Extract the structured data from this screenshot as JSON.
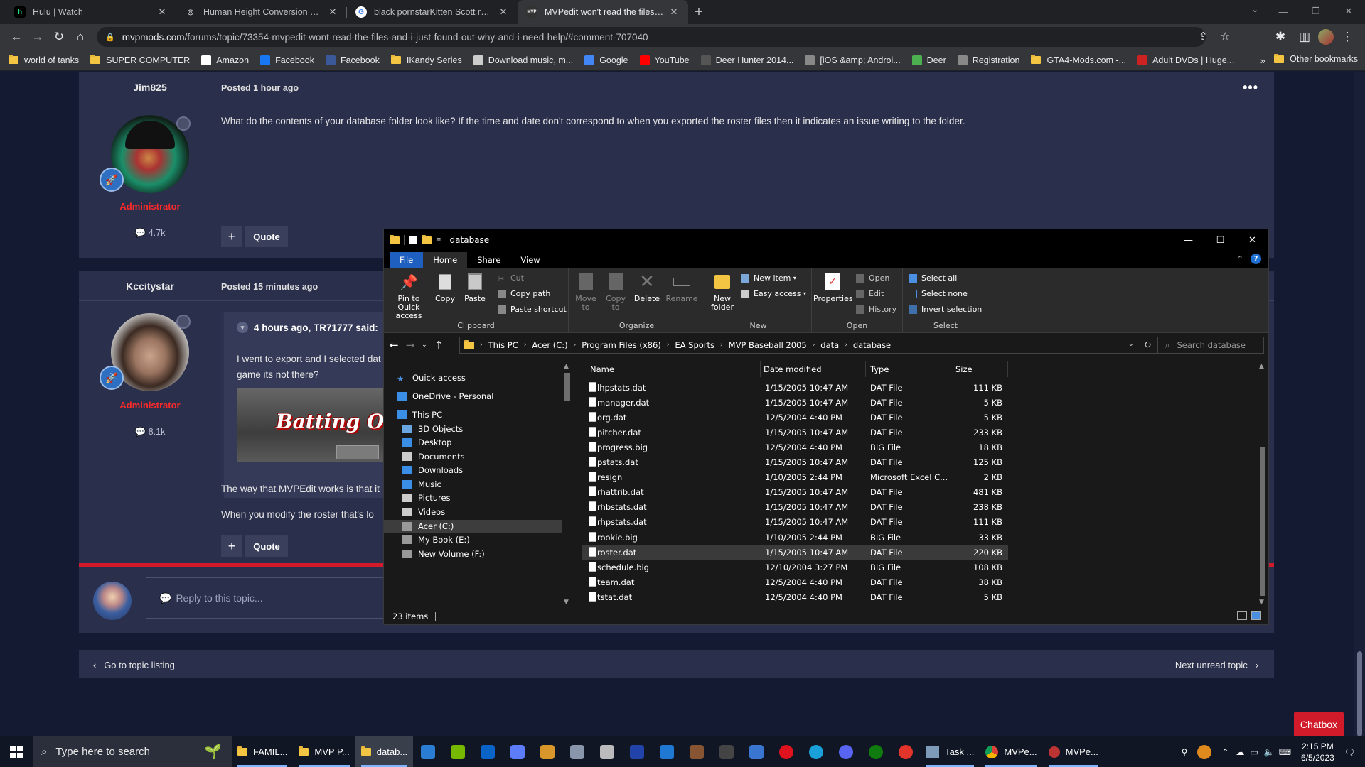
{
  "browser": {
    "tabs": [
      {
        "title": "Hulu | Watch",
        "fav": "h",
        "fav_color": "#1ce783",
        "fav_bg": "#000"
      },
      {
        "title": "Human Height Conversion Table",
        "fav": "◎",
        "fav_color": "#bdc1c6",
        "fav_bg": "transparent"
      },
      {
        "title": "black pornstarKitten Scott real na",
        "fav": "G",
        "fav_color": "#4285f4",
        "fav_bg": "#fff"
      },
      {
        "title": "MVPedit won't read the files and",
        "fav": "MVP",
        "fav_color": "#fff",
        "fav_bg": "#333"
      }
    ],
    "url_host": "mvpmods.com",
    "url_path": "/forums/topic/73354-mvpedit-wont-read-the-files-and-i-just-found-out-why-and-i-need-help/#comment-707040",
    "bookmarks": [
      {
        "label": "world of tanks",
        "icon": "folder-icon",
        "color": "#f4c542"
      },
      {
        "label": "SUPER COMPUTER",
        "icon": "folder-icon",
        "color": "#f4c542"
      },
      {
        "label": "Amazon",
        "icon": "amazon-icon",
        "color": "#fff"
      },
      {
        "label": "Facebook",
        "icon": "facebook-icon",
        "color": "#1877f2"
      },
      {
        "label": "Facebook",
        "icon": "facebook-icon",
        "color": "#3b5998"
      },
      {
        "label": "IKandy Series",
        "icon": "folder-icon",
        "color": "#f4c542"
      },
      {
        "label": "Download music, m...",
        "icon": "download-icon",
        "color": "#ccc"
      },
      {
        "label": "Google",
        "icon": "google-icon",
        "color": "#4285f4"
      },
      {
        "label": "YouTube",
        "icon": "youtube-icon",
        "color": "#ff0000"
      },
      {
        "label": "Deer Hunter 2014...",
        "icon": "deer-icon",
        "color": "#555"
      },
      {
        "label": "[iOS &amp; Androi...",
        "icon": "web-icon",
        "color": "#888"
      },
      {
        "label": "Deer",
        "icon": "check-icon",
        "color": "#4caf50"
      },
      {
        "label": "Registration",
        "icon": "web-icon",
        "color": "#888"
      },
      {
        "label": "GTA4-Mods.com -...",
        "icon": "folder-icon",
        "color": "#f4c542"
      },
      {
        "label": "Adult DVDs | Huge...",
        "icon": "star-icon",
        "color": "#c22"
      }
    ],
    "more": "»",
    "other_bookmarks": "Other bookmarks"
  },
  "forum": {
    "post1": {
      "author": "Jim825",
      "posted": "Posted 1 hour ago",
      "role": "Administrator",
      "rep": "4.7k",
      "text": "What do the contents of your database folder look like?  If the time and  date don't correspond to when you exported the roster files then it indicates an issue writing to the folder.",
      "plus": "+",
      "quote": "Quote",
      "more": "•••"
    },
    "post2": {
      "author": "Kccitystar",
      "posted": "Posted 15 minutes ago",
      "role": "Administrator",
      "rep": "8.1k",
      "quote_head": "4 hours ago, TR71777 said:",
      "quote_line1": "I went to export and I selected dat",
      "quote_line2": "game its not there?",
      "quote_img_text": "Batting Ord",
      "text1": "The way that MVPEdit works is that it",
      "text2": "When you modify the roster that's lo",
      "plus": "+",
      "quote": "Quote"
    },
    "reply_placeholder": "Reply to this topic...",
    "go_to_listing": "Go to topic listing",
    "next_unread": "Next unread topic",
    "chatbox": "Chatbox"
  },
  "explorer": {
    "title": "database",
    "tabs": [
      "File",
      "Home",
      "Share",
      "View"
    ],
    "ribbon": {
      "clipboard": {
        "name": "Clipboard",
        "pin": "Pin to Quick access",
        "copy": "Copy",
        "paste": "Paste",
        "cut": "Cut",
        "copy_path": "Copy path",
        "paste_shortcut": "Paste shortcut"
      },
      "organize": {
        "name": "Organize",
        "move_to": "Move to",
        "copy_to": "Copy to",
        "delete": "Delete",
        "rename": "Rename"
      },
      "new": {
        "name": "New",
        "new_folder": "New folder",
        "new_item": "New item",
        "easy_access": "Easy access"
      },
      "open": {
        "name": "Open",
        "properties": "Properties",
        "open": "Open",
        "edit": "Edit",
        "history": "History"
      },
      "select": {
        "name": "Select",
        "select_all": "Select all",
        "select_none": "Select none",
        "invert": "Invert selection"
      }
    },
    "breadcrumb": [
      "This PC",
      "Acer (C:)",
      "Program Files (x86)",
      "EA Sports",
      "MVP Baseball 2005",
      "data",
      "database"
    ],
    "search_placeholder": "Search database",
    "nav": [
      {
        "label": "Quick access",
        "icon": "star-icon"
      },
      {
        "label": "OneDrive - Personal",
        "icon": "cloud-icon"
      },
      {
        "label": "This PC",
        "icon": "pc-icon"
      },
      {
        "label": "3D Objects",
        "icon": "cube-icon"
      },
      {
        "label": "Desktop",
        "icon": "desktop-icon"
      },
      {
        "label": "Documents",
        "icon": "document-icon"
      },
      {
        "label": "Downloads",
        "icon": "download-icon"
      },
      {
        "label": "Music",
        "icon": "music-icon"
      },
      {
        "label": "Pictures",
        "icon": "picture-icon"
      },
      {
        "label": "Videos",
        "icon": "video-icon"
      },
      {
        "label": "Acer (C:)",
        "icon": "drive-icon"
      },
      {
        "label": "My Book (E:)",
        "icon": "drive-icon"
      },
      {
        "label": "New Volume (F:)",
        "icon": "drive-icon"
      }
    ],
    "columns": [
      "Name",
      "Date modified",
      "Type",
      "Size"
    ],
    "files": [
      {
        "name": "lhpstats.dat",
        "date": "1/15/2005 10:47 AM",
        "type": "DAT File",
        "size": "111 KB"
      },
      {
        "name": "manager.dat",
        "date": "1/15/2005 10:47 AM",
        "type": "DAT File",
        "size": "5 KB"
      },
      {
        "name": "org.dat",
        "date": "12/5/2004 4:40 PM",
        "type": "DAT File",
        "size": "5 KB"
      },
      {
        "name": "pitcher.dat",
        "date": "1/15/2005 10:47 AM",
        "type": "DAT File",
        "size": "233 KB"
      },
      {
        "name": "progress.big",
        "date": "12/5/2004 4:40 PM",
        "type": "BIG File",
        "size": "18 KB"
      },
      {
        "name": "pstats.dat",
        "date": "1/15/2005 10:47 AM",
        "type": "DAT File",
        "size": "125 KB"
      },
      {
        "name": "resign",
        "date": "1/10/2005 2:44 PM",
        "type": "Microsoft Excel C...",
        "size": "2 KB"
      },
      {
        "name": "rhattrib.dat",
        "date": "1/15/2005 10:47 AM",
        "type": "DAT File",
        "size": "481 KB"
      },
      {
        "name": "rhbstats.dat",
        "date": "1/15/2005 10:47 AM",
        "type": "DAT File",
        "size": "238 KB"
      },
      {
        "name": "rhpstats.dat",
        "date": "1/15/2005 10:47 AM",
        "type": "DAT File",
        "size": "111 KB"
      },
      {
        "name": "rookie.big",
        "date": "1/10/2005 2:44 PM",
        "type": "BIG File",
        "size": "33 KB"
      },
      {
        "name": "roster.dat",
        "date": "1/15/2005 10:47 AM",
        "type": "DAT File",
        "size": "220 KB"
      },
      {
        "name": "schedule.big",
        "date": "12/10/2004 3:27 PM",
        "type": "BIG File",
        "size": "108 KB"
      },
      {
        "name": "team.dat",
        "date": "12/5/2004 4:40 PM",
        "type": "DAT File",
        "size": "38 KB"
      },
      {
        "name": "tstat.dat",
        "date": "12/5/2004 4:40 PM",
        "type": "DAT File",
        "size": "5 KB"
      }
    ],
    "selected_file": "roster.dat",
    "status": "23 items"
  },
  "taskbar": {
    "search_placeholder": "Type here to search",
    "apps": [
      {
        "label": "FAMIL...",
        "icon": "folder-icon"
      },
      {
        "label": "MVP P...",
        "icon": "folder-icon"
      },
      {
        "label": "datab...",
        "icon": "folder-icon"
      }
    ],
    "task_label": "Task ...",
    "chrome_label": "MVPe...",
    "mvp_label": "MVPe...",
    "time": "2:15 PM",
    "date": "6/5/2023"
  }
}
